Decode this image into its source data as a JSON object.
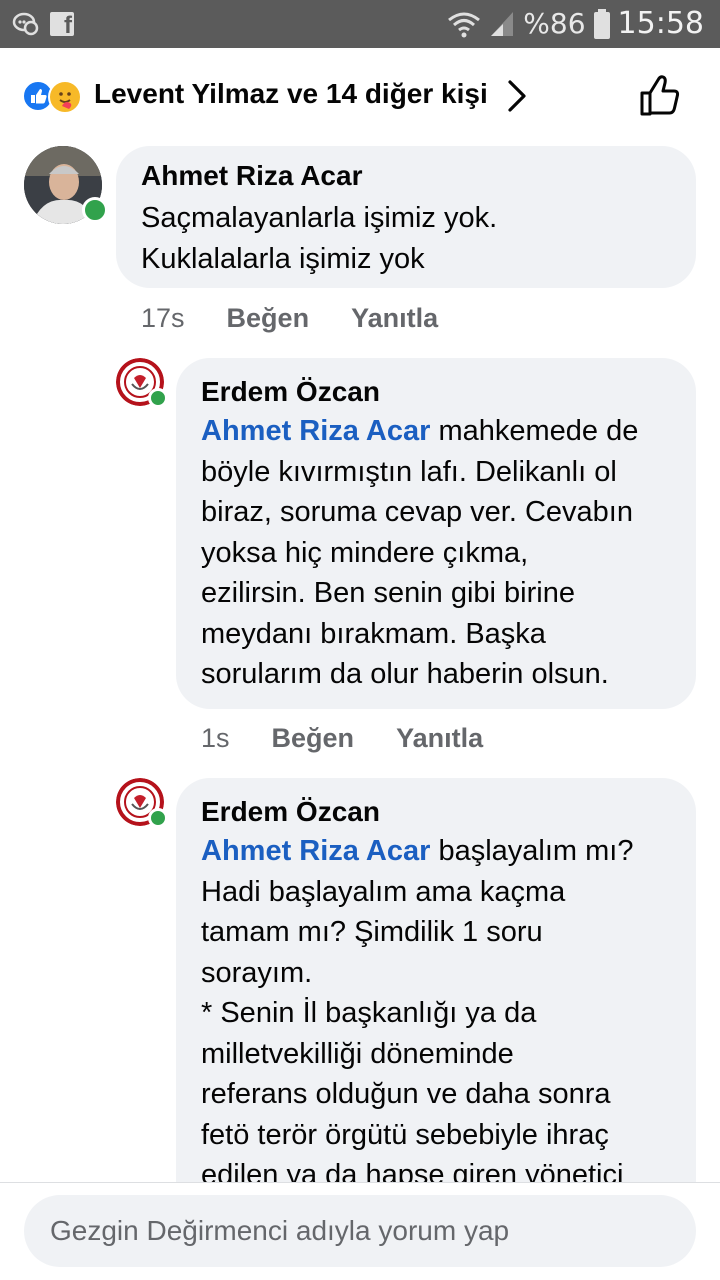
{
  "status_bar": {
    "battery": "%86",
    "time": "15:58",
    "icons": [
      "messenger-icon",
      "facebook-icon",
      "wifi-icon",
      "signal-icon",
      "battery-icon"
    ]
  },
  "reactions": {
    "label": "Levent Yilmaz ve 14 diğer kişi",
    "icons": [
      "like-reaction-icon",
      "care-reaction-icon"
    ]
  },
  "comments": [
    {
      "author": "Ahmet Riza Acar",
      "lines": [
        "Saçmalayanlarla işimiz yok.",
        "Kuklalalarla işimiz yok"
      ],
      "time": "17s",
      "like_label": "Beğen",
      "reply_label": "Yanıtla"
    },
    {
      "author": "Erdem Özcan",
      "mention": "Ahmet Riza Acar",
      "first_line_rest": " mahkemede de",
      "lines": [
        "böyle kıvırmıştın lafı. Delikanlı ol",
        "biraz, soruma cevap ver. Cevabın",
        "yoksa hiç mindere çıkma,",
        "ezilirsin. Ben senin gibi birine",
        "meydanı bırakmam. Başka",
        "sorularım da olur haberin olsun."
      ],
      "time": "1s",
      "like_label": "Beğen",
      "reply_label": "Yanıtla"
    },
    {
      "author": "Erdem Özcan",
      "mention": "Ahmet Riza Acar",
      "first_line_rest": " başlayalım mı?",
      "lines": [
        "Hadi başlayalım ama kaçma",
        "tamam mı? Şimdilik 1 soru",
        "sorayım.",
        "* Senin İl başkanlığı ya da",
        "milletvekilliği döneminde",
        "referans olduğun ve daha sonra",
        "fetö terör örgütü sebebiyle ihraç",
        "edilen ya da hapse giren yönetici"
      ]
    }
  ],
  "composer": {
    "placeholder": "Gezgin Değirmenci adıyla yorum yap"
  },
  "colors": {
    "status_bar": "#5b5b5b",
    "bubble": "#f0f2f5",
    "mention": "#1b5fc1",
    "online": "#31a24c",
    "meta": "#65676b"
  }
}
